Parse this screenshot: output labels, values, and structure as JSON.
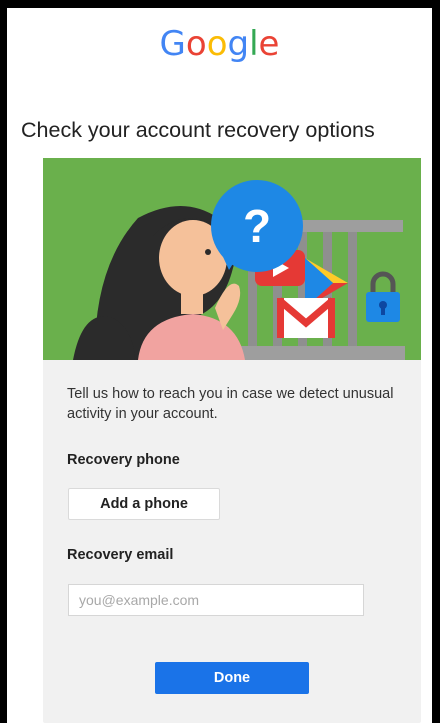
{
  "logo": {
    "letters": [
      {
        "char": "G",
        "color": "#4285f4"
      },
      {
        "char": "o",
        "color": "#ea4335"
      },
      {
        "char": "o",
        "color": "#fbbc05"
      },
      {
        "char": "g",
        "color": "#4285f4"
      },
      {
        "char": "l",
        "color": "#34a853"
      },
      {
        "char": "e",
        "color": "#ea4335"
      }
    ]
  },
  "page": {
    "title": "Check your account recovery options"
  },
  "card": {
    "description": "Tell us how to reach you in case we detect unusual activity in your account.",
    "phone_label": "Recovery phone",
    "phone_button": "Add a phone",
    "email_label": "Recovery email",
    "email_placeholder": "you@example.com",
    "email_value": "",
    "done_button": "Done"
  },
  "illustration": {
    "question_mark": "?",
    "icons": [
      "question-bubble-icon",
      "youtube-icon",
      "play-store-icon",
      "gmail-icon",
      "padlock-icon"
    ]
  },
  "colors": {
    "hero_bg": "#6ab04c",
    "accent_blue": "#1a73e8",
    "bubble_blue": "#1e88e5",
    "card_bg": "#f1f1f1"
  }
}
